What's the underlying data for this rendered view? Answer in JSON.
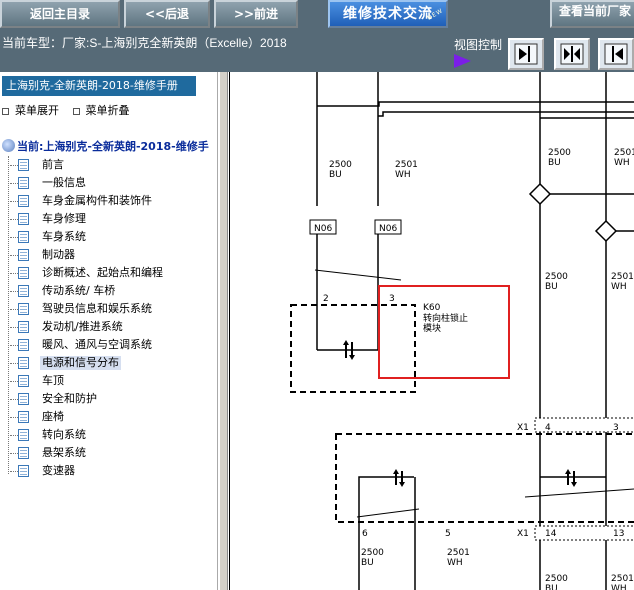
{
  "toolbar": {
    "home_label": "返回主目录",
    "back_label": "<<后退",
    "forward_label": ">>前进",
    "forum_label": "维修技术交流",
    "forum_badge": "NEW",
    "query_label": "查看当前厂家"
  },
  "model_bar": {
    "current_model": "当前车型：厂家:S-上海别克全新英朗（Excelle）2018",
    "view_control_label": "视图控制"
  },
  "sidebar": {
    "manual_title": "上海别克-全新英朗-2018-维修手册",
    "expand_label": "菜单展开",
    "collapse_label": "菜单折叠",
    "current_label": "当前:上海别克-全新英朗-2018-维修手",
    "items": [
      "前言",
      "一般信息",
      "车身金属构件和装饰件",
      "车身修理",
      "车身系统",
      "制动器",
      "诊断概述、起始点和编程",
      "传动系统/ 车桥",
      "驾驶员信息和娱乐系统",
      "发动机/推进系统",
      "暖风、通风与空调系统",
      "电源和信号分布",
      "车顶",
      "安全和防护",
      "座椅",
      "转向系统",
      "悬架系统",
      "变速器"
    ],
    "selected_index": 11
  },
  "diagram": {
    "wire_labels": [
      {
        "gauge": "2500",
        "color": "BU"
      },
      {
        "gauge": "2501",
        "color": "WH"
      },
      {
        "gauge": "2500",
        "color": "BU"
      },
      {
        "gauge": "2501",
        "color": "WH"
      },
      {
        "gauge": "2500",
        "color": "BU"
      },
      {
        "gauge": "2501",
        "color": "WH"
      },
      {
        "gauge": "2500",
        "color": "BU"
      },
      {
        "gauge": "2501",
        "color": "WH"
      },
      {
        "gauge": "2500",
        "color": "BU"
      },
      {
        "gauge": "2501",
        "color": "WH"
      }
    ],
    "connector_tags": [
      "N06",
      "N06"
    ],
    "pins": [
      "2",
      "3",
      "4",
      "3",
      "6",
      "5",
      "14",
      "13"
    ],
    "connector_ids": [
      "X1",
      "X1"
    ],
    "module_id": "K60",
    "module_name_line1": "转向柱锁止",
    "module_name_line2": "模块",
    "highlight_color": "#e02020"
  }
}
